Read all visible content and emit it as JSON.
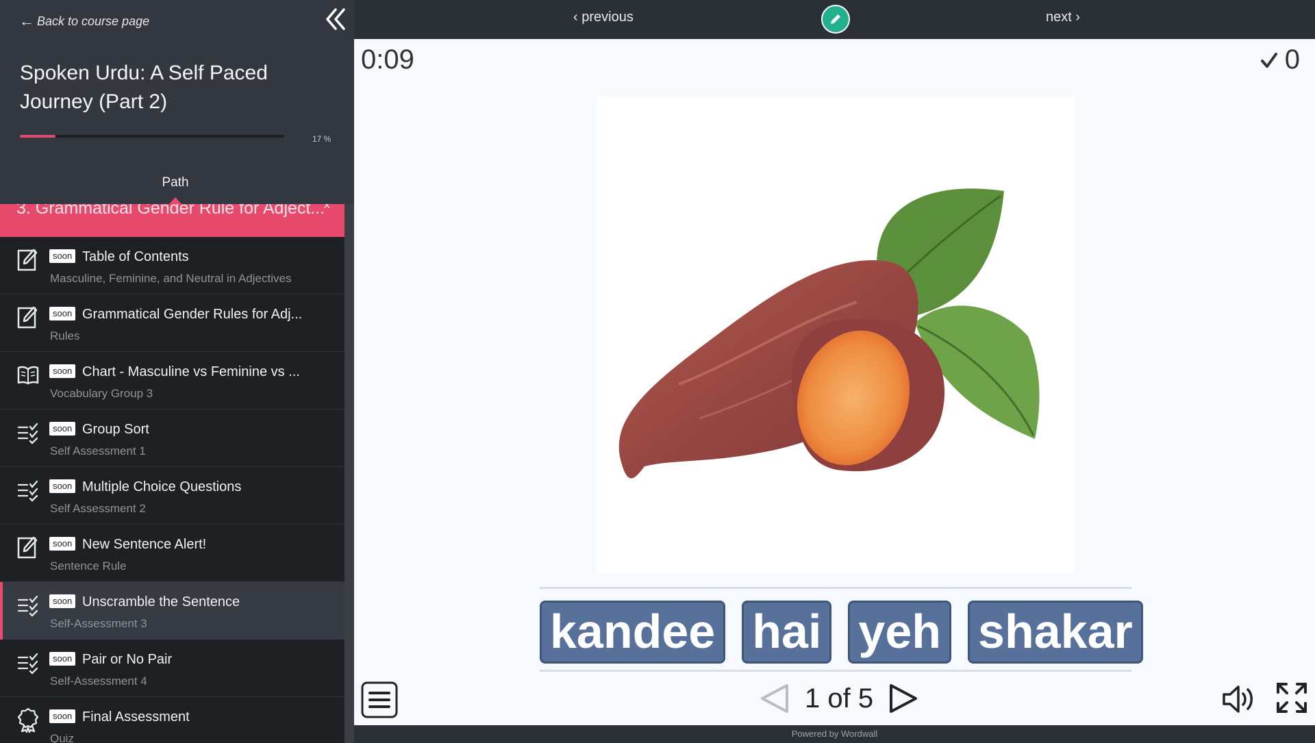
{
  "sidebar": {
    "back_label": "Back to course page",
    "course_title": "Spoken Urdu: A Self Paced Journey (Part 2)",
    "progress": {
      "percent": 17,
      "label": "17 %"
    },
    "tab_label": "Path",
    "section": {
      "title": "3. Grammatical Gender Rule for Adject...",
      "close": "×"
    },
    "items": [
      {
        "badge": "soon",
        "title": "Table of Contents",
        "subtitle": "Masculine, Feminine, and Neutral in Adjectives",
        "icon": "assignment-edit-icon"
      },
      {
        "badge": "soon",
        "title": "Grammatical Gender Rules for Adj...",
        "subtitle": "Rules",
        "icon": "assignment-edit-icon"
      },
      {
        "badge": "soon",
        "title": "Chart - Masculine vs Feminine vs ...",
        "subtitle": "Vocabulary Group 3",
        "icon": "open-book-icon"
      },
      {
        "badge": "soon",
        "title": "Group Sort",
        "subtitle": "Self Assessment 1",
        "icon": "checklist-icon"
      },
      {
        "badge": "soon",
        "title": "Multiple Choice Questions",
        "subtitle": "Self Assessment 2",
        "icon": "checklist-icon"
      },
      {
        "badge": "soon",
        "title": "New Sentence Alert!",
        "subtitle": "Sentence Rule",
        "icon": "assignment-edit-icon"
      },
      {
        "badge": "soon",
        "title": "Unscramble the Sentence",
        "subtitle": "Self-Assessment 3",
        "icon": "checklist-icon",
        "active": true
      },
      {
        "badge": "soon",
        "title": "Pair or No Pair",
        "subtitle": "Self-Assessment 4",
        "icon": "checklist-icon"
      },
      {
        "badge": "soon",
        "title": "Final Assessment",
        "subtitle": "Quiz",
        "icon": "award-badge-icon"
      }
    ]
  },
  "nav": {
    "previous": "previous",
    "next": "next"
  },
  "game": {
    "timer": "0:09",
    "score": "0",
    "words": [
      "kandee",
      "hai",
      "yeh",
      "shakar"
    ],
    "pager": "1 of 5"
  },
  "footer": "Powered by Wordwall",
  "colors": {
    "accent": "#e84a6d",
    "tile": "#57719b",
    "edit_button": "#23b08f"
  }
}
